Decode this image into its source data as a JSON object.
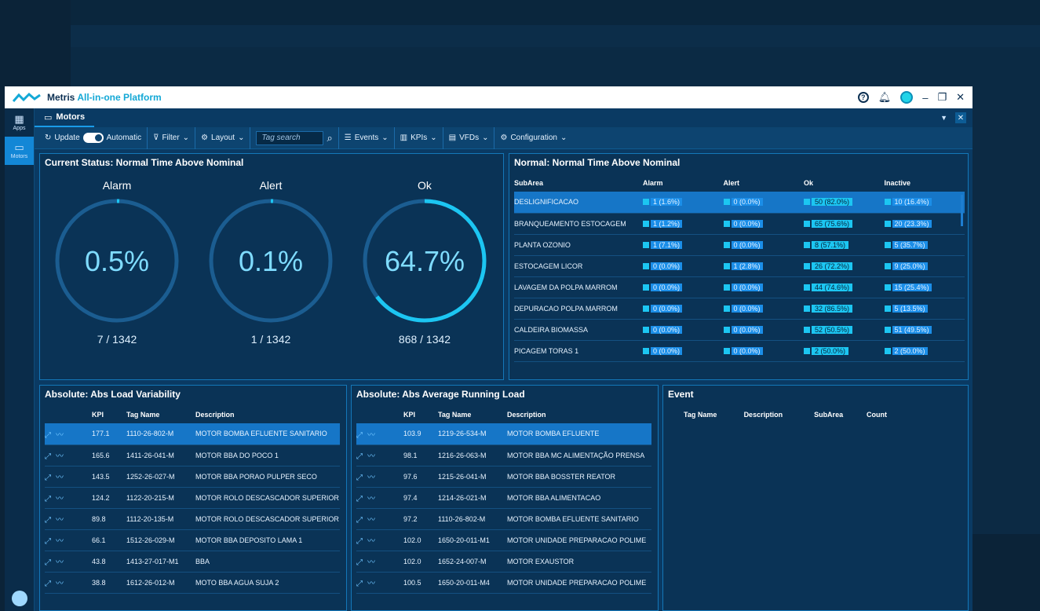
{
  "app": {
    "brand": "Metris",
    "brand_sub": "All-in-one Platform"
  },
  "sidebar": {
    "items": [
      {
        "label": "Apps"
      },
      {
        "label": "Motors"
      }
    ]
  },
  "tab": {
    "label": "Motors"
  },
  "toolbar": {
    "update": "Update",
    "automatic": "Automatic",
    "filter": "Filter",
    "layout": "Layout",
    "search_placeholder": "Tag search",
    "events": "Events",
    "kpis": "KPIs",
    "vfds": "VFDs",
    "configuration": "Configuration"
  },
  "status_panel": {
    "title": "Current Status: Normal Time Above Nominal",
    "gauges": [
      {
        "label": "Alarm",
        "value": "0.5%",
        "count": "7 / 1342",
        "fraction": 0.005
      },
      {
        "label": "Alert",
        "value": "0.1%",
        "count": "1 / 1342",
        "fraction": 0.001
      },
      {
        "label": "Ok",
        "value": "64.7%",
        "count": "868 / 1342",
        "fraction": 0.647
      }
    ]
  },
  "normal_panel": {
    "title": "Normal: Normal Time Above Nominal",
    "headers": [
      "SubArea",
      "Alarm",
      "Alert",
      "Ok",
      "Inactive"
    ],
    "rows": [
      [
        "DESLIGNIFICACAO",
        "1 (1.6%)",
        "0 (0.0%)",
        "50 (82.0%)",
        "10 (16.4%)"
      ],
      [
        "BRANQUEAMENTO ESTOCAGEM",
        "1 (1.2%)",
        "0 (0.0%)",
        "65 (75.6%)",
        "20 (23.3%)"
      ],
      [
        "PLANTA OZONIO",
        "1 (7.1%)",
        "0 (0.0%)",
        "8 (57.1%)",
        "5 (35.7%)"
      ],
      [
        "ESTOCAGEM LICOR",
        "0 (0.0%)",
        "1 (2.8%)",
        "26 (72.2%)",
        "9 (25.0%)"
      ],
      [
        "LAVAGEM DA POLPA MARROM",
        "0 (0.0%)",
        "0 (0.0%)",
        "44 (74.6%)",
        "15 (25.4%)"
      ],
      [
        "DEPURACAO POLPA MARROM",
        "0 (0.0%)",
        "0 (0.0%)",
        "32 (86.5%)",
        "5 (13.5%)"
      ],
      [
        "CALDEIRA BIOMASSA",
        "0 (0.0%)",
        "0 (0.0%)",
        "52 (50.5%)",
        "51 (49.5%)"
      ],
      [
        "PICAGEM TORAS 1",
        "0 (0.0%)",
        "0 (0.0%)",
        "2 (50.0%)",
        "2 (50.0%)"
      ]
    ]
  },
  "load_var_panel": {
    "title": "Absolute: Abs Load Variability",
    "headers": [
      "KPI",
      "Tag Name",
      "Description"
    ],
    "rows": [
      [
        "177.1",
        "1110-26-802-M",
        "MOTOR BOMBA EFLUENTE SANITARIO"
      ],
      [
        "165.6",
        "1411-26-041-M",
        "MOTOR BBA DO POCO 1"
      ],
      [
        "143.5",
        "1252-26-027-M",
        "MOTOR BBA PORAO PULPER SECO"
      ],
      [
        "124.2",
        "1122-20-215-M",
        "MOTOR ROLO DESCASCADOR SUPERIOR"
      ],
      [
        "89.8",
        "1112-20-135-M",
        "MOTOR ROLO DESCASCADOR SUPERIOR"
      ],
      [
        "66.1",
        "1512-26-029-M",
        "MOTOR BBA DEPOSITO LAMA 1"
      ],
      [
        "43.8",
        "1413-27-017-M1",
        "BBA"
      ],
      [
        "38.8",
        "1612-26-012-M",
        "MOTO BBA AGUA SUJA 2"
      ]
    ]
  },
  "running_load_panel": {
    "title": "Absolute: Abs Average Running Load",
    "headers": [
      "KPI",
      "Tag Name",
      "Description"
    ],
    "rows": [
      [
        "103.9",
        "1219-26-534-M",
        "MOTOR BOMBA EFLUENTE"
      ],
      [
        "98.1",
        "1216-26-063-M",
        "MOTOR BBA MC ALIMENTAÇÃO PRENSA"
      ],
      [
        "97.6",
        "1215-26-041-M",
        "MOTOR BBA BOSSTER REATOR"
      ],
      [
        "97.4",
        "1214-26-021-M",
        "MOTOR BBA ALIMENTACAO"
      ],
      [
        "97.2",
        "1110-26-802-M",
        "MOTOR BOMBA EFLUENTE SANITARIO"
      ],
      [
        "102.0",
        "1650-20-011-M1",
        "MOTOR UNIDADE PREPARACAO POLIME"
      ],
      [
        "102.0",
        "1652-24-007-M",
        "MOTOR EXAUSTOR"
      ],
      [
        "100.5",
        "1650-20-011-M4",
        "MOTOR UNIDADE PREPARACAO POLIME"
      ]
    ]
  },
  "event_panel": {
    "title": "Event",
    "headers": [
      "Tag Name",
      "Description",
      "SubArea",
      "Count"
    ]
  },
  "colors": {
    "accent": "#1cc6f2",
    "background": "#0a3a63",
    "selection": "#1676c7"
  }
}
